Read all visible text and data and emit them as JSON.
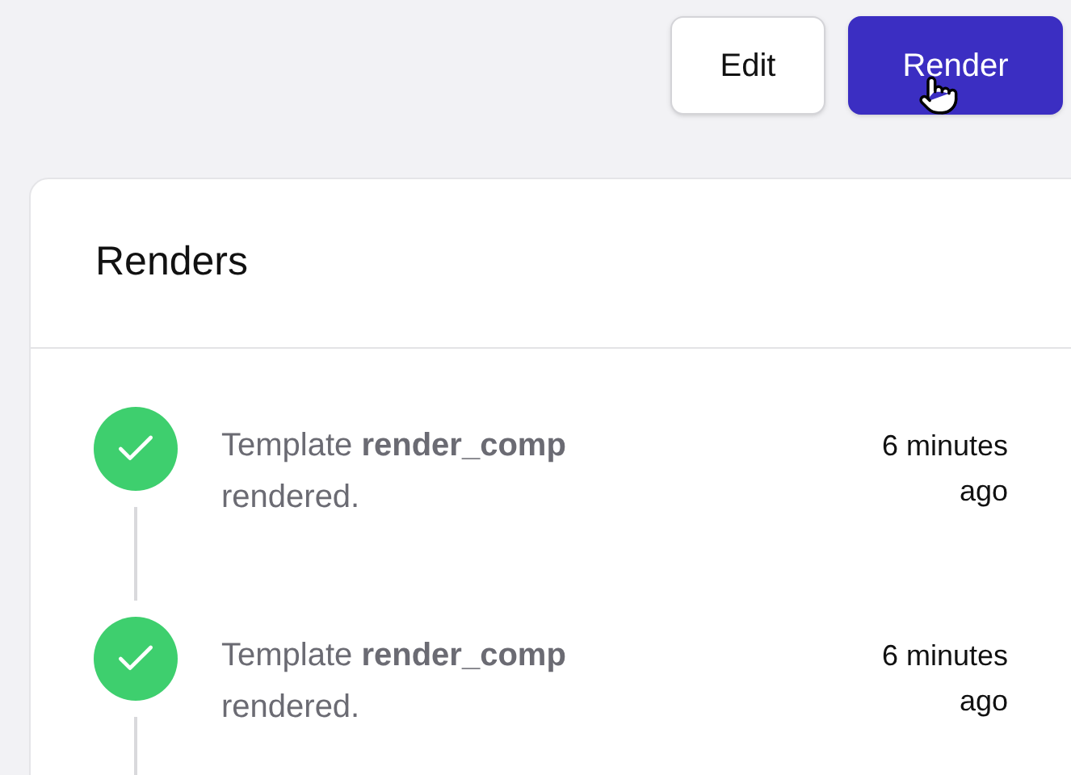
{
  "header_buttons": [
    {
      "label": "Edit",
      "kind": "secondary"
    },
    {
      "label": "Render",
      "kind": "primary"
    }
  ],
  "card": {
    "title": "Renders",
    "events": [
      {
        "message": "Template **render_comp** rendered.",
        "time": "6 minutes ago"
      },
      {
        "message": "Template **render_comp** rendered.",
        "time": "6 minutes ago"
      }
    ]
  }
}
